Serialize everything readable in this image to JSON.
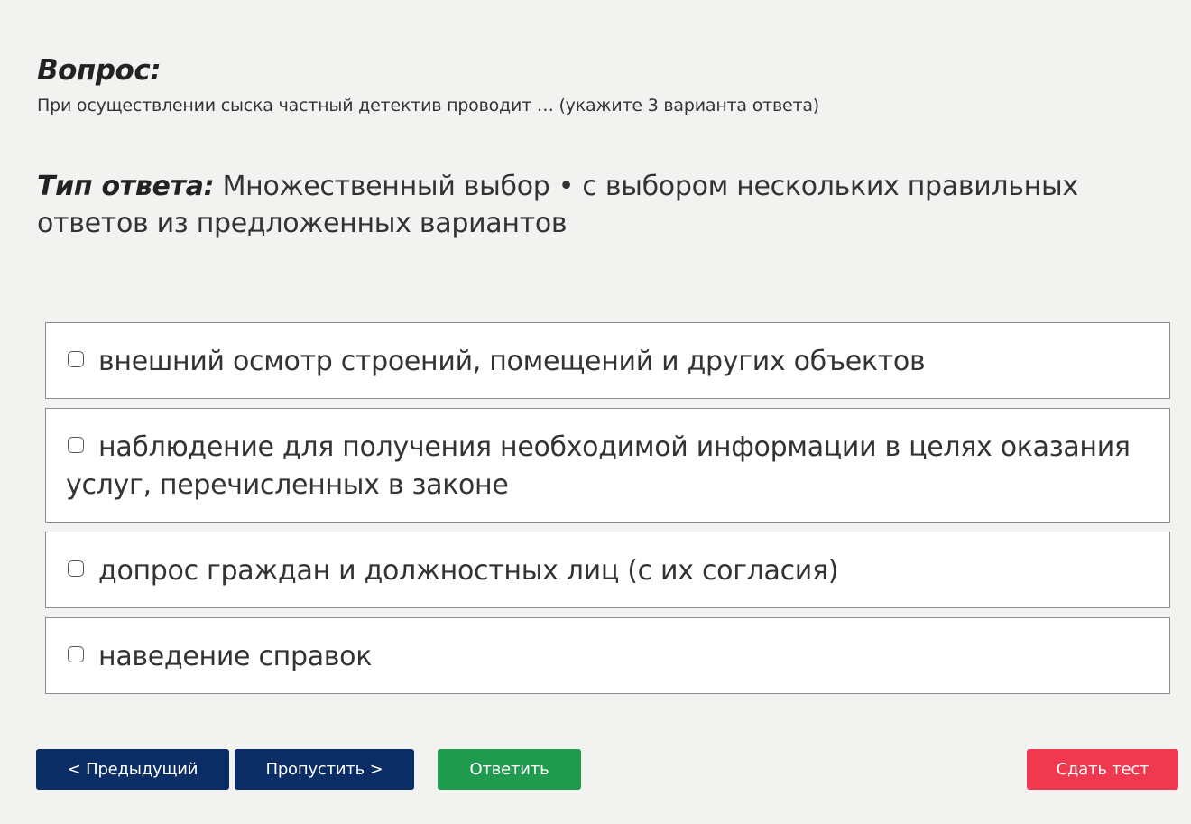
{
  "question": {
    "heading": "Вопрос:",
    "text": "При осуществлении сыска частный детектив проводит … (укажите 3 варианта ответа)"
  },
  "answer_type": {
    "label": "Тип ответа:",
    "value": " Множественный выбор • с выбором нескольких правильных ответов из предложенных вариантов"
  },
  "options": [
    {
      "label": "внешний осмотр строений, помещений и других объектов",
      "checked": false
    },
    {
      "label": "наблюдение для получения необходимой информации в целях оказания услуг, перечисленных в законе",
      "checked": false
    },
    {
      "label": "допрос граждан и должностных лиц (с их согласия)",
      "checked": false
    },
    {
      "label": "наведение справок",
      "checked": false
    }
  ],
  "buttons": {
    "prev": "< Предыдущий",
    "skip": "Пропустить >",
    "answer": "Ответить",
    "submit": "Сдать тест"
  },
  "colors": {
    "background": "#f2f2f0",
    "nav_button": "#0b2d66",
    "answer_button": "#209a4d",
    "submit_button": "#f0394f"
  }
}
